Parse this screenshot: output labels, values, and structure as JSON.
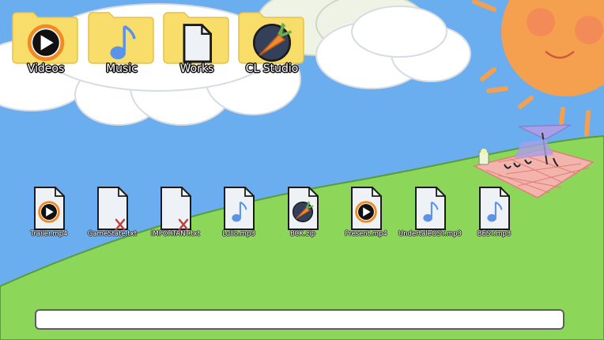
{
  "folders": [
    {
      "label": "Videos",
      "icon": "play-icon"
    },
    {
      "label": "Music",
      "icon": "music-note-icon"
    },
    {
      "label": "Works",
      "icon": "document-icon"
    },
    {
      "label": "CL Studio",
      "icon": "carrot-logo-icon"
    }
  ],
  "files": [
    {
      "name": "Trailer.mp4",
      "icon": "play-icon",
      "broken": false
    },
    {
      "name": "GameState.txt",
      "icon": "document-icon",
      "broken": true
    },
    {
      "name": "IMPORTANT.txt",
      "icon": "document-icon",
      "broken": true
    },
    {
      "name": "Lullo.mp3",
      "icon": "music-note-icon",
      "broken": false
    },
    {
      "name": "BCK.zip",
      "icon": "carrot-logo-icon",
      "broken": false
    },
    {
      "name": "Present.mp4",
      "icon": "play-icon",
      "broken": false
    },
    {
      "name": "UndertaleOST.mp3",
      "icon": "music-note-icon",
      "broken": false
    },
    {
      "name": "BEST.mp3",
      "icon": "music-note-icon",
      "broken": false
    }
  ],
  "colors": {
    "sky": "#6aaef0",
    "grass": "#8cd65a",
    "folder": "#f9dd6b",
    "sun": "#f5a04f",
    "note": "#5a93e8",
    "play_ring": "#f28a24",
    "broken_x": "#c0403f"
  },
  "taskbar": {
    "value": ""
  }
}
